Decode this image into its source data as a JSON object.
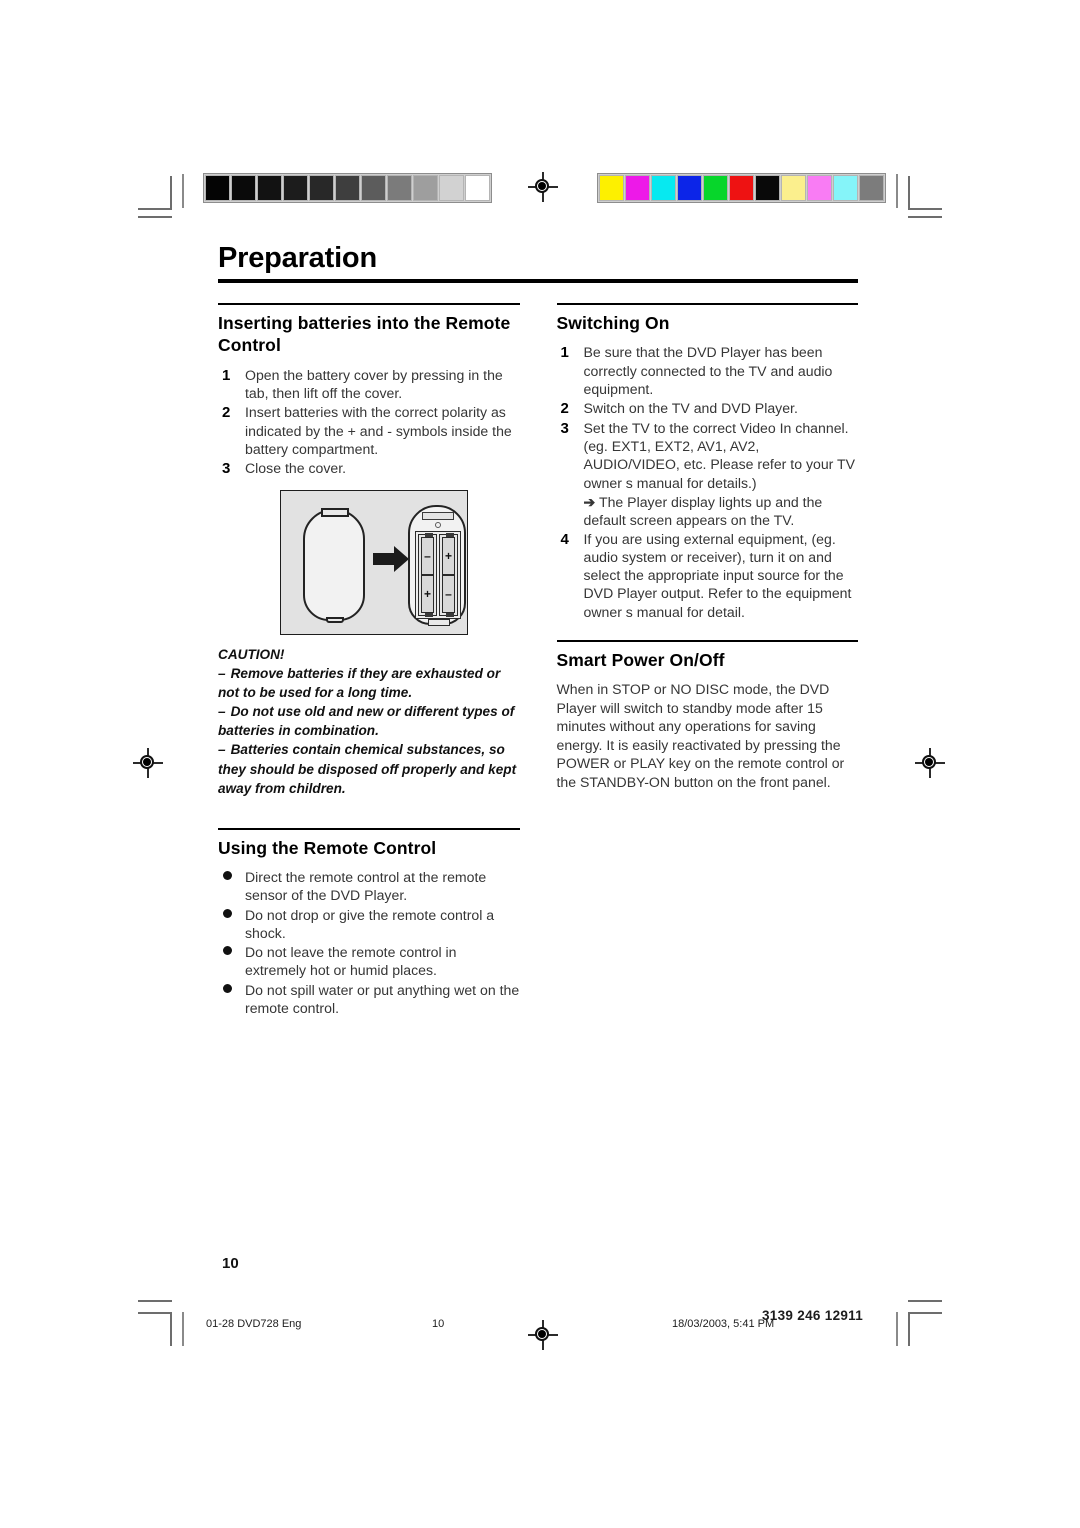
{
  "page_title": "Preparation",
  "folio": "10",
  "left_column": {
    "section1": {
      "heading": "Inserting batteries into the Remote Control",
      "steps": [
        {
          "num": "1",
          "text": "Open the battery cover by pressing in the tab, then lift off the cover."
        },
        {
          "num": "2",
          "text": "Insert batteries with the correct polarity as indicated by the + and - symbols inside the battery compartment."
        },
        {
          "num": "3",
          "text": "Close the cover."
        }
      ],
      "figure": {
        "label": "remote-control-battery-insertion-diagram",
        "cell_left_top": "–",
        "cell_left_bottom": "+",
        "cell_right_top": "+",
        "cell_right_bottom": "–"
      }
    },
    "caution": {
      "heading": "CAUTION!",
      "items": [
        "Remove batteries if they are exhausted or not to be used for a long time.",
        "Do not use old and new or different types of batteries in combination.",
        "Batteries contain chemical substances, so they should be disposed off properly and kept away from children."
      ],
      "dash": "–"
    },
    "section2": {
      "heading": "Using the Remote Control",
      "bullets": [
        "Direct the remote control at the remote sensor of the DVD Player.",
        "Do not drop or give the remote control a shock.",
        "Do not leave the remote control in extremely hot or humid places.",
        "Do not spill water or put anything wet on the remote control."
      ]
    }
  },
  "right_column": {
    "section1": {
      "heading": "Switching On",
      "steps": [
        {
          "num": "1",
          "text": "Be sure that the DVD Player has been correctly connected to the TV and audio equipment."
        },
        {
          "num": "2",
          "text": "Switch on the TV and DVD Player."
        },
        {
          "num": "3",
          "text": "Set the TV to the correct Video In channel. (eg. EXT1, EXT2, AV1, AV2, AUDIO/VIDEO, etc. Please refer to your TV owner s manual for details.)"
        }
      ],
      "note": {
        "arrow": "➔",
        "text": "The Player display lights up and the default screen appears on the TV."
      },
      "step4": {
        "num": "4",
        "text": "If you are using external equipment, (eg. audio system or receiver), turn it on and select the appropriate input source for the DVD Player output. Refer to the equipment owner s manual for detail."
      }
    },
    "section2": {
      "heading": "Smart Power On/Off",
      "body": "When in STOP or NO DISC mode, the DVD Player will switch to standby mode after 15 minutes without any operations for saving energy. It is easily reactivated by pressing the POWER or PLAY key on the remote control or the STANDBY-ON button on the front panel."
    }
  },
  "footer": {
    "file": "01-28 DVD728 Eng",
    "page": "10",
    "date": "18/03/2003, 5:41 PM",
    "code": "3139 246 12911"
  },
  "print_marks": {
    "grayscale_swatches": [
      "#040404",
      "#0a0a0a",
      "#121212",
      "#1c1c1c",
      "#282828",
      "#3e3e3e",
      "#5c5c5c",
      "#7b7b7b",
      "#9e9e9e",
      "#d2d2d2",
      "#ffffff"
    ],
    "color_swatches": [
      "#fdf000",
      "#ed19e8",
      "#07e9f0",
      "#0c25e8",
      "#07d62b",
      "#ee1212",
      "#090909",
      "#fbef8d",
      "#f97cf4",
      "#85f4f9",
      "#7c7c7c"
    ]
  }
}
